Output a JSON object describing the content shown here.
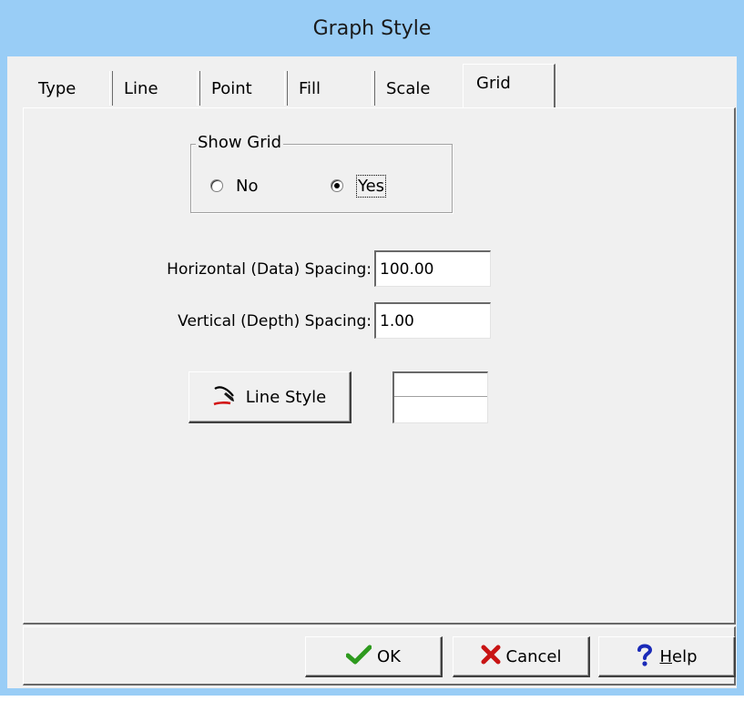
{
  "window": {
    "title": "Graph Style"
  },
  "tabs": [
    {
      "label": "Type",
      "active": false
    },
    {
      "label": "Line",
      "active": false
    },
    {
      "label": "Point",
      "active": false
    },
    {
      "label": "Fill",
      "active": false
    },
    {
      "label": "Scale",
      "active": false
    },
    {
      "label": "Grid",
      "active": true
    }
  ],
  "show_grid": {
    "legend": "Show Grid",
    "options": [
      {
        "label": "No",
        "selected": false
      },
      {
        "label": "Yes",
        "selected": true
      }
    ]
  },
  "fields": {
    "horizontal": {
      "label": "Horizontal (Data) Spacing:",
      "value": "100.00"
    },
    "vertical": {
      "label": "Vertical (Depth) Spacing:",
      "value": "1.00"
    }
  },
  "line_style": {
    "button_label": "Line Style",
    "icon": "pen-line-icon"
  },
  "buttons": {
    "ok": {
      "label": "OK",
      "icon": "checkmark-icon",
      "icon_color": "#2e9a1e"
    },
    "cancel": {
      "label": "Cancel",
      "icon": "x-icon",
      "icon_color": "#c81414"
    },
    "help": {
      "label_prefix": "",
      "label_underlined": "H",
      "label_rest": "elp",
      "icon": "question-icon",
      "icon_color": "#1a2ab8"
    }
  },
  "colors": {
    "titlebar": "#99cdf6",
    "face": "#f0f0f0"
  }
}
